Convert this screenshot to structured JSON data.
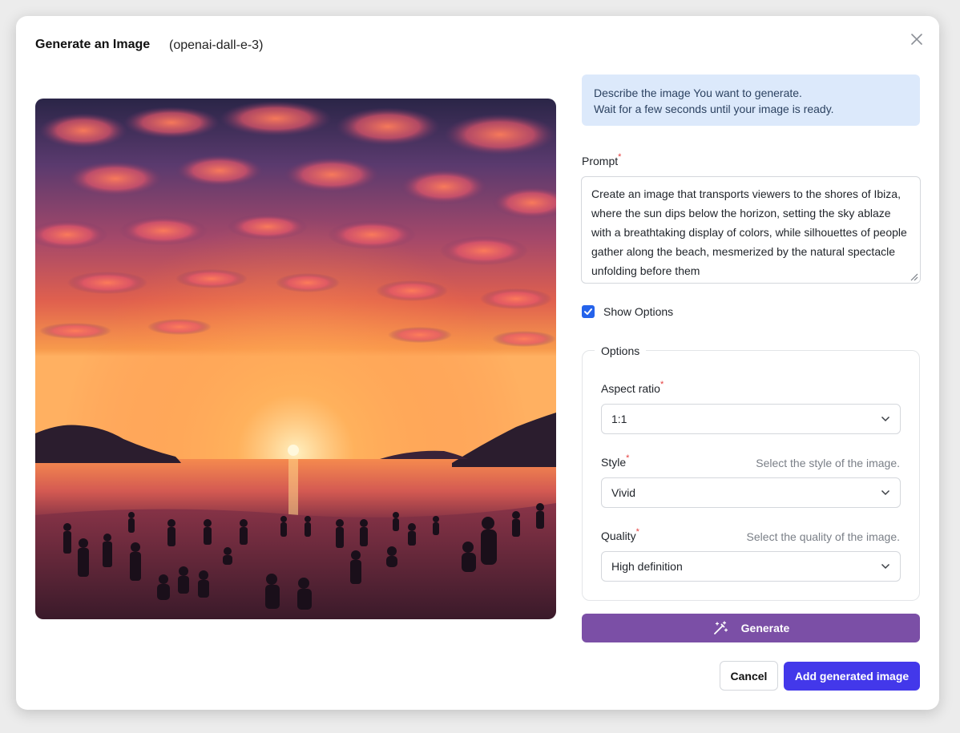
{
  "dialog": {
    "title": "Generate an Image",
    "model": "(openai-dall-e-3)"
  },
  "image": {
    "alt": "Generated image: sunset over Ibiza beach with silhouettes of people"
  },
  "info": {
    "line1": "Describe the image You want to generate.",
    "line2": "Wait for a few seconds until your image is ready."
  },
  "prompt": {
    "label": "Prompt",
    "required_mark": "*",
    "value": "Create an image that transports viewers to the shores of Ibiza, where the sun dips below the horizon, setting the sky ablaze with a breathtaking display of colors, while silhouettes of people gather along the beach, mesmerized by the natural spectacle unfolding before them"
  },
  "show_options": {
    "label": "Show Options",
    "checked": true
  },
  "options": {
    "legend": "Options",
    "aspect_ratio": {
      "label": "Aspect ratio",
      "value": "1:1"
    },
    "style": {
      "label": "Style",
      "hint": "Select the style of the image.",
      "value": "Vivid"
    },
    "quality": {
      "label": "Quality",
      "hint": "Select the quality of the image.",
      "value": "High definition"
    }
  },
  "actions": {
    "generate": "Generate",
    "cancel": "Cancel",
    "add": "Add generated image"
  },
  "colors": {
    "generate_bg": "#7b4fa6",
    "add_bg": "#4338ea",
    "info_bg": "#dce9fb",
    "checkbox": "#2563eb",
    "required": "#e53e3e"
  }
}
